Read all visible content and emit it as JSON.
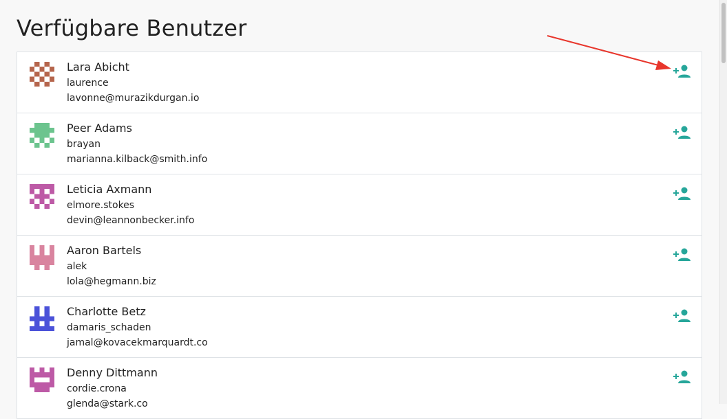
{
  "page": {
    "title": "Verfügbare Benutzer"
  },
  "colors": {
    "accent": "#26a69a",
    "annotation": "#e8362c"
  },
  "icons": {
    "add_user": "person-add-icon",
    "annotation": "red-arrow-icon"
  },
  "users": [
    {
      "name": "Lara Abicht",
      "login": "laurence",
      "email": "lavonne@murazikdurgan.io",
      "avatar_color": "#b5654c"
    },
    {
      "name": "Peer Adams",
      "login": "brayan",
      "email": "marianna.kilback@smith.info",
      "avatar_color": "#6cc48e"
    },
    {
      "name": "Leticia Axmann",
      "login": "elmore.stokes",
      "email": "devin@leannonbecker.info",
      "avatar_color": "#bd5aa6"
    },
    {
      "name": "Aaron Bartels",
      "login": "alek",
      "email": "lola@hegmann.biz",
      "avatar_color": "#d9849f"
    },
    {
      "name": "Charlotte Betz",
      "login": "damaris_schaden",
      "email": "jamal@kovacekmarquardt.co",
      "avatar_color": "#4b52d9"
    },
    {
      "name": "Denny Dittmann",
      "login": "cordie.crona",
      "email": "glenda@stark.co",
      "avatar_color": "#bd5aa6"
    }
  ]
}
